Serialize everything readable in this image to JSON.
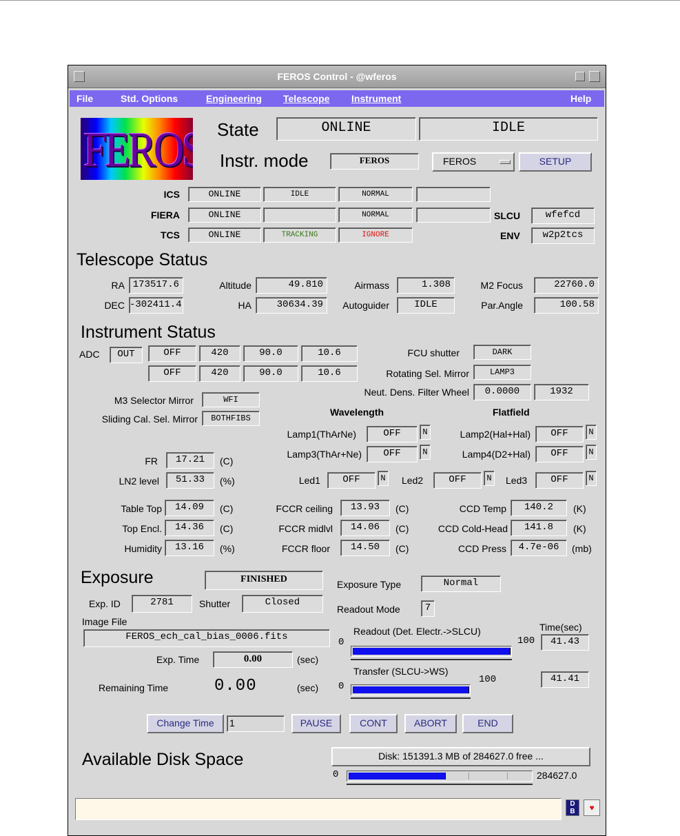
{
  "window": {
    "title": "FEROS Control - @wferos"
  },
  "menu": {
    "file": "File",
    "std_options": "Std. Options",
    "engineering": "Engineering",
    "telescope": "Telescope",
    "instrument": "Instrument",
    "help": "Help"
  },
  "logo_text": "FEROS",
  "header": {
    "state_label": "State",
    "state_value": "ONLINE",
    "substate_value": "IDLE",
    "instr_mode_label": "Instr. mode",
    "instr_mode_value": "FEROS",
    "mode_select": "FEROS",
    "setup_button": "SETUP"
  },
  "subsystems": {
    "ics": {
      "label": "ICS",
      "state": "ONLINE",
      "substate": "IDLE",
      "mode": "NORMAL",
      "extra": ""
    },
    "fiera": {
      "label": "FIERA",
      "state": "ONLINE",
      "substate": "",
      "mode": "NORMAL",
      "extra": ""
    },
    "tcs": {
      "label": "TCS",
      "state": "ONLINE",
      "substate": "TRACKING",
      "mode": "IGNORE"
    },
    "slcu": {
      "label": "SLCU",
      "value": "wfefcd"
    },
    "env": {
      "label": "ENV",
      "value": "w2p2tcs"
    },
    "colors": {
      "tracking": "#3a7a1a",
      "ignore": "#e01010"
    }
  },
  "telescope": {
    "title": "Telescope Status",
    "ra": {
      "label": "RA",
      "value": "173517.6"
    },
    "dec": {
      "label": "DEC",
      "value": "-302411.4"
    },
    "altitude": {
      "label": "Altitude",
      "value": "49.810"
    },
    "ha": {
      "label": "HA",
      "value": "30634.39"
    },
    "airmass": {
      "label": "Airmass",
      "value": "1.308"
    },
    "autoguider": {
      "label": "Autoguider",
      "value": "IDLE"
    },
    "m2focus": {
      "label": "M2 Focus",
      "value": "22760.0"
    },
    "parangle": {
      "label": "Par.Angle",
      "value": "100.58"
    }
  },
  "instrument": {
    "title": "Instrument Status",
    "adc_label": "ADC",
    "adc_state": "OUT",
    "adc_row1": [
      "OFF",
      "420",
      "90.0",
      "10.6"
    ],
    "adc_row2": [
      "OFF",
      "420",
      "90.0",
      "10.6"
    ],
    "fcu_shutter": {
      "label": "FCU shutter",
      "value": "DARK"
    },
    "rot_mirror": {
      "label": "Rotating Sel. Mirror",
      "value": "LAMP3"
    },
    "ndf_wheel": {
      "label": "Neut. Dens. Filter Wheel",
      "value1": "0.0000",
      "value2": "1932"
    },
    "m3_mirror": {
      "label": "M3 Selector Mirror",
      "value": "WFI"
    },
    "sliding_mirror": {
      "label": "Sliding Cal. Sel. Mirror",
      "value": "BOTHFIBS"
    },
    "wavelength_label": "Wavelength",
    "flatfield_label": "Flatfield",
    "lamp1": {
      "label": "Lamp1(ThArNe)",
      "value": "OFF",
      "flag": "N"
    },
    "lamp2": {
      "label": "Lamp2(Hal+Hal)",
      "value": "OFF",
      "flag": "N"
    },
    "lamp3": {
      "label": "Lamp3(ThAr+Ne)",
      "value": "OFF",
      "flag": "N"
    },
    "lamp4": {
      "label": "Lamp4(D2+Hal)",
      "value": "OFF",
      "flag": "N"
    },
    "led1": {
      "label": "Led1",
      "value": "OFF",
      "flag": "N"
    },
    "led2": {
      "label": "Led2",
      "value": "OFF",
      "flag": "N"
    },
    "led3": {
      "label": "Led3",
      "value": "OFF",
      "flag": "N"
    },
    "fr": {
      "label": "FR",
      "value": "17.21",
      "unit": "(C)"
    },
    "ln2": {
      "label": "LN2 level",
      "value": "51.33",
      "unit": "(%)"
    },
    "table_top": {
      "label": "Table Top",
      "value": "14.09",
      "unit": "(C)"
    },
    "top_encl": {
      "label": "Top Encl.",
      "value": "14.36",
      "unit": "(C)"
    },
    "humidity": {
      "label": "Humidity",
      "value": "13.16",
      "unit": "(%)"
    },
    "fccr_ceiling": {
      "label": "FCCR ceiling",
      "value": "13.93",
      "unit": "(C)"
    },
    "fccr_midlvl": {
      "label": "FCCR midlvl",
      "value": "14.06",
      "unit": "(C)"
    },
    "fccr_floor": {
      "label": "FCCR floor",
      "value": "14.50",
      "unit": "(C)"
    },
    "ccd_temp": {
      "label": "CCD Temp",
      "value": "140.2",
      "unit": "(K)"
    },
    "ccd_coldhead": {
      "label": "CCD Cold-Head",
      "value": "141.8",
      "unit": "(K)"
    },
    "ccd_press": {
      "label": "CCD Press",
      "value": "4.7e-06",
      "unit": "(mb)"
    }
  },
  "exposure": {
    "title": "Exposure",
    "status": "FINISHED",
    "type_label": "Exposure Type",
    "type_value": "Normal",
    "exp_id_label": "Exp. ID",
    "exp_id_value": "2781",
    "shutter_label": "Shutter",
    "shutter_value": "Closed",
    "readout_mode_label": "Readout Mode",
    "readout_mode_value": "7",
    "image_file_label": "Image File",
    "image_file_value": "FEROS_ech_cal_bias_0006.fits",
    "exp_time_label": "Exp. Time",
    "exp_time_value": "0.00",
    "exp_time_unit": "(sec)",
    "remaining_label": "Remaining Time",
    "remaining_value": "0.00",
    "remaining_unit": "(sec)",
    "time_header": "Time(sec)",
    "readout": {
      "label": "Readout (Det. Electr.->SLCU)",
      "min": "0",
      "max": "100",
      "progress": 1.0,
      "time": "41.43"
    },
    "transfer": {
      "label": "Transfer (SLCU->WS)",
      "min": "0",
      "max": "100",
      "progress": 1.0,
      "time": "41.41"
    }
  },
  "controls": {
    "change_time": "Change Time",
    "time_input": "1",
    "pause": "PAUSE",
    "cont": "CONT",
    "abort": "ABORT",
    "end": "END"
  },
  "disk": {
    "title": "Available Disk Space",
    "button": "Disk: 151391.3 MB of 284627.0 free ...",
    "min": "0",
    "max": "284627.0",
    "free_fraction": 0.532
  },
  "statusbar": {
    "text": "",
    "db_icon": "DB"
  }
}
